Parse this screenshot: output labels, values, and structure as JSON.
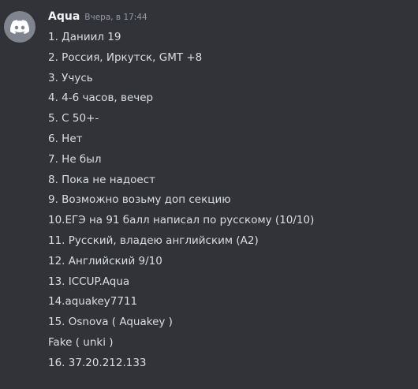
{
  "message": {
    "author": "Aqua",
    "timestamp": "Вчера, в 17:44",
    "avatar_icon": "discord-logo-icon",
    "avatar_color": "#80848e",
    "lines": [
      "1. Даниил 19",
      "2. Россия, Иркутск, GMT +8",
      "3. Учусь",
      "4. 4-6 часов, вечер",
      "5. С 50+-",
      "6. Нет",
      "7. Не был",
      "8. Пока не надоест",
      "9. Возможно возьму доп секцию",
      "10.ЕГЭ на 91 балл написал по русскому (10/10)",
      "11. Русский, владею английским (А2)",
      "12. Английский 9/10",
      "13. ICCUP.Aqua",
      "14.aquakey7711",
      "15. Osnova ( Aquakey )",
      "Fake ( unki )",
      "16. 37.20.212.133"
    ]
  },
  "colors": {
    "background": "#313338",
    "username": "#f2f3f5",
    "timestamp": "#949ba4",
    "text": "#dbdee1"
  }
}
